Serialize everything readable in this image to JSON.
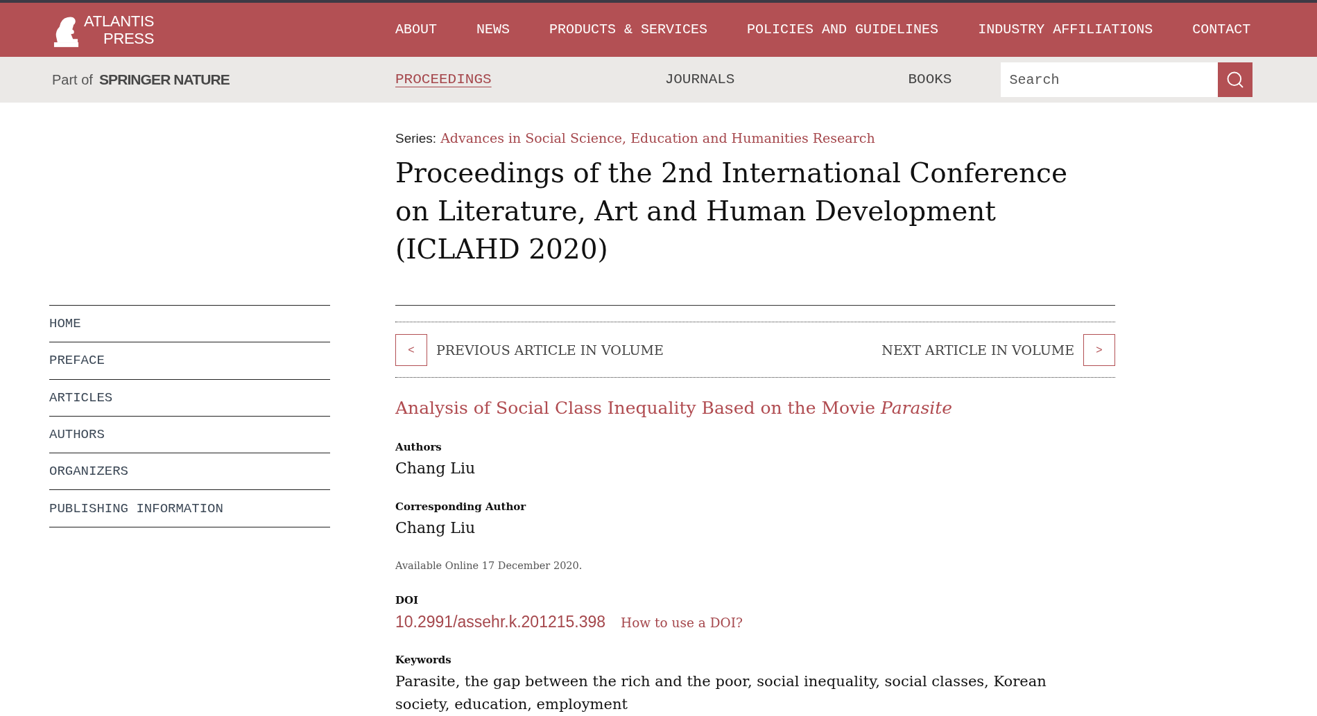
{
  "header": {
    "logo_text": [
      "ATLANTIS",
      "PRESS"
    ],
    "nav": [
      "ABOUT",
      "NEWS",
      "PRODUCTS & SERVICES",
      "POLICIES AND GUIDELINES",
      "INDUSTRY AFFILIATIONS",
      "CONTACT"
    ]
  },
  "subheader": {
    "affiliation_prefix": "Part of",
    "affiliation_brand": "SPRINGER NATURE",
    "tabs": [
      {
        "label": "PROCEEDINGS",
        "selected": true
      },
      {
        "label": "JOURNALS",
        "selected": false
      },
      {
        "label": "BOOKS",
        "selected": false
      }
    ],
    "search": {
      "placeholder": "Search"
    }
  },
  "series": {
    "label": "Series:",
    "link": "Advances in Social Science, Education and Humanities Research"
  },
  "title": "Proceedings of the 2nd International Conference on Literature, Art and Human Development (ICLAHD 2020)",
  "sidebar": {
    "items": [
      "HOME",
      "PREFACE",
      "ARTICLES",
      "AUTHORS",
      "ORGANIZERS",
      "PUBLISHING INFORMATION"
    ]
  },
  "article_nav": {
    "previous": {
      "arrow": "<",
      "label": "PREVIOUS ARTICLE IN VOLUME"
    },
    "next": {
      "arrow": ">",
      "label": "NEXT ARTICLE IN VOLUME"
    }
  },
  "article": {
    "title": "Analysis of Social Class Inequality Based on the Movie *Parasite*",
    "fields": [
      {
        "kind": "text",
        "label": "Authors",
        "value": "Chang Liu"
      },
      {
        "kind": "text",
        "label": "Corresponding Author",
        "value": "Chang Liu"
      },
      {
        "kind": "note",
        "value": "Available Online 17 December 2020."
      },
      {
        "kind": "doi",
        "label": "DOI",
        "value": "10.2991/assehr.k.201215.398",
        "help": "How to use a DOI?"
      },
      {
        "kind": "keywords",
        "label": "Keywords",
        "value": "Parasite, the gap between the rich and the poor, social inequality, social classes, Korean society, education, employment"
      }
    ]
  }
}
